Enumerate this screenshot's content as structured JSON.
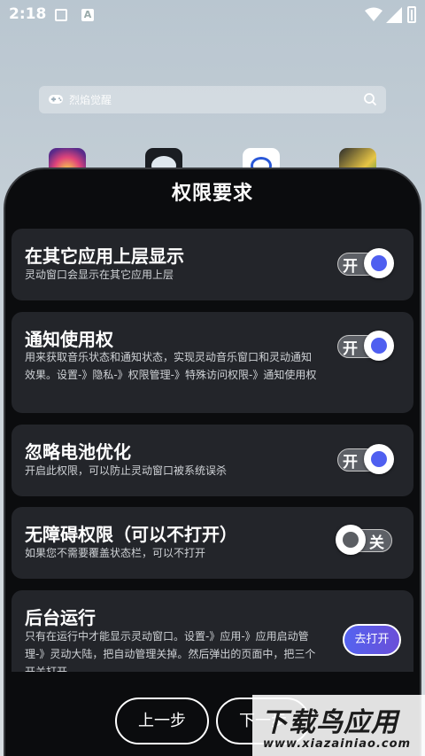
{
  "status_bar": {
    "time": "2:18",
    "icons": [
      "image-icon",
      "a-notification-icon",
      "wifi-icon",
      "signal-icon",
      "battery-charging-icon"
    ]
  },
  "search": {
    "placeholder": "烈焰觉醒"
  },
  "dialog": {
    "title": "权限要求",
    "permissions": [
      {
        "title": "在其它应用上层显示",
        "description": "灵动窗口会显示在其它应用上层",
        "control": "toggle",
        "state": "on",
        "toggle_label": "开"
      },
      {
        "title": "通知使用权",
        "description": "用来获取音乐状态和通知状态，实现灵动音乐窗口和灵动通知效果。设置-》隐私-》权限管理-》特殊访问权限-》通知使用权",
        "control": "toggle",
        "state": "on",
        "toggle_label": "开"
      },
      {
        "title": "忽略电池优化",
        "description": "开启此权限，可以防止灵动窗口被系统误杀",
        "control": "toggle",
        "state": "on",
        "toggle_label": "开"
      },
      {
        "title": "无障碍权限（可以不打开）",
        "description": "如果您不需要覆盖状态栏，可以不打开",
        "control": "toggle",
        "state": "off",
        "toggle_label": "关"
      },
      {
        "title": "后台运行",
        "description": "只有在运行中才能显示灵动窗口。设置-》应用-》应用启动管理-》灵动大陆，把自动管理关掉。然后弹出的页面中，把三个开关打开",
        "control": "button",
        "button_label": "去打开"
      }
    ],
    "prev_label": "上一步",
    "next_label": "下一步"
  },
  "watermark": {
    "main": "下载鸟应用",
    "url": "www.xiazainiao.com"
  },
  "colors": {
    "accent": "#4f5ff0",
    "card_bg": "#23252a",
    "dialog_bg": "#0b0c0e"
  }
}
